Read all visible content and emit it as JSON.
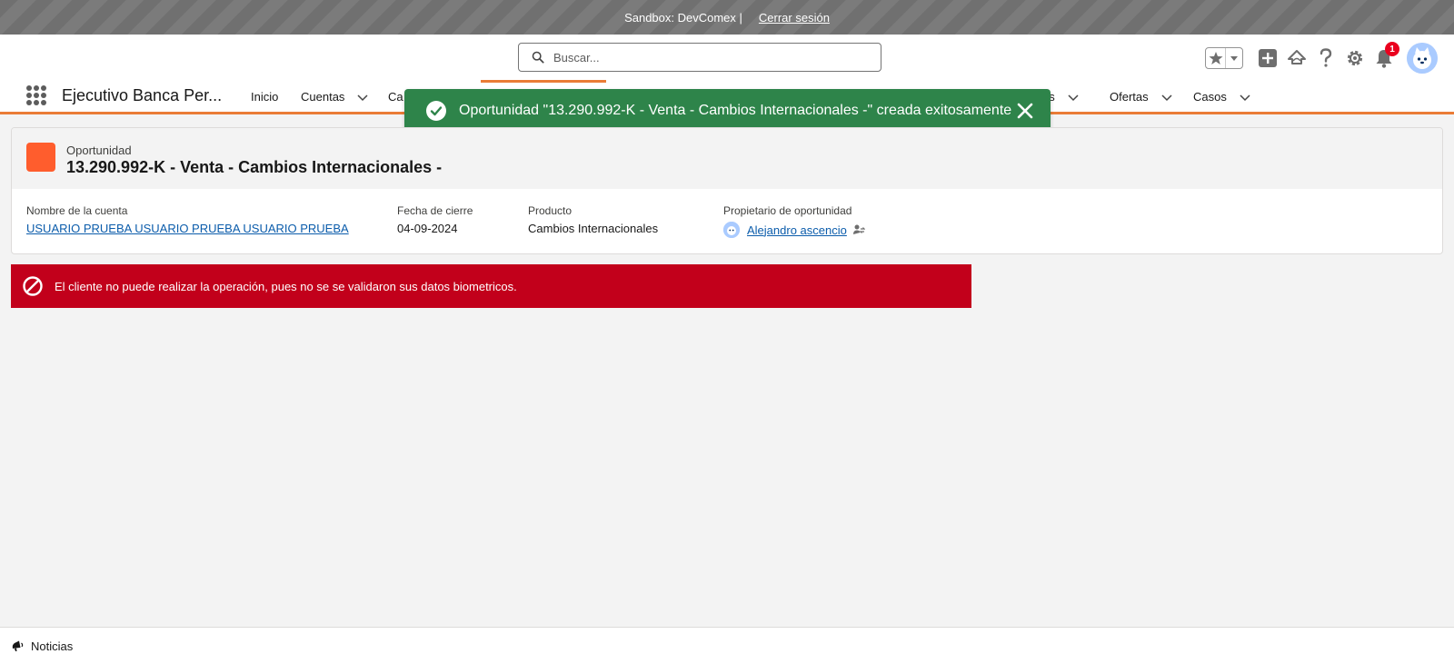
{
  "sandbox": {
    "label": "Sandbox: DevComex |",
    "logout": "Cerrar sesión"
  },
  "search": {
    "placeholder": "Buscar..."
  },
  "notifications": {
    "count": "1"
  },
  "app": {
    "name": "Ejecutivo Banca Per..."
  },
  "nav": {
    "items": [
      {
        "label": "Inicio"
      },
      {
        "label": "Cuentas"
      },
      {
        "label": "Ca"
      },
      {
        "label": "os"
      },
      {
        "label": "Ofertas"
      },
      {
        "label": "Casos"
      }
    ]
  },
  "toast": {
    "message": "Oportunidad \"13.290.992-K - Venta - Cambios Internacionales -\" creada exitosamente",
    "color": "#2e844a"
  },
  "record": {
    "type": "Oportunidad",
    "title": "13.290.992-K - Venta - Cambios Internacionales -",
    "icon_color": "#ff5d2d",
    "fields": [
      {
        "label": "Nombre de la cuenta",
        "value": "USUARIO PRUEBA USUARIO PRUEBA USUARIO PRUEBA"
      },
      {
        "label": "Fecha de cierre",
        "value": "04-09-2024"
      },
      {
        "label": "Producto",
        "value": "Cambios Internacionales"
      },
      {
        "label": "Propietario de oportunidad",
        "value": "Alejandro ascencio"
      }
    ]
  },
  "error": {
    "message": "El cliente no puede realizar la operación, pues no se se validaron sus datos biometricos.",
    "color": "#c2001b"
  },
  "footer": {
    "label": "Noticias"
  },
  "icons": [
    "search-icon",
    "favorites-star-icon",
    "chevron-down-icon",
    "add-icon",
    "trailhead-icon",
    "help-icon",
    "setup-gear-icon",
    "notifications-bell-icon",
    "waffle-icon",
    "success-check-icon",
    "close-icon",
    "ban-icon",
    "change-owner-icon",
    "news-feed-icon"
  ]
}
